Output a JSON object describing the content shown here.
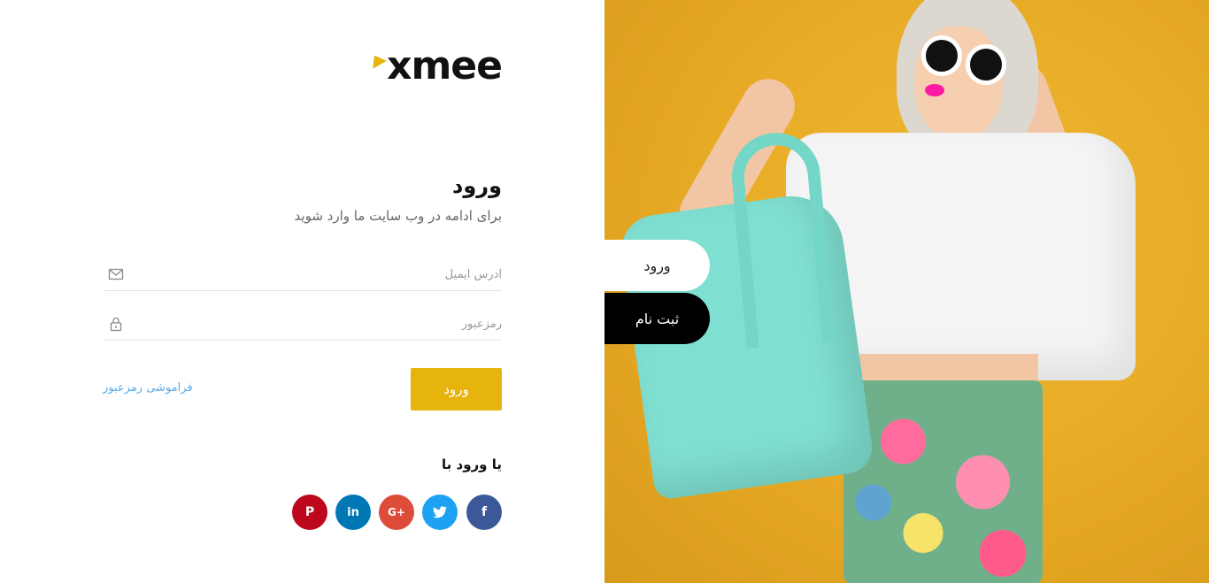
{
  "brand": {
    "logo_text": "xmee",
    "accent_color": "#e6b40c"
  },
  "login": {
    "title": "ورود",
    "subtitle": "برای ادامه در وب سایت ما وارد شوید",
    "email_placeholder": "آدرس ایمیل",
    "password_placeholder": "رمزعبور",
    "submit_label": "ورود",
    "forgot_label": "فراموشی رمزعبور"
  },
  "social": {
    "heading": "یا ورود با",
    "buttons": [
      {
        "name": "facebook",
        "glyph": "f",
        "color": "#3b5998"
      },
      {
        "name": "twitter",
        "glyph": "t",
        "color": "#1da1f2"
      },
      {
        "name": "google-plus",
        "glyph": "G+",
        "color": "#dd4b39"
      },
      {
        "name": "linkedin",
        "glyph": "in",
        "color": "#0077b5"
      },
      {
        "name": "pinterest",
        "glyph": "P",
        "color": "#bd081c"
      }
    ]
  },
  "tabs": {
    "login_label": "ورود",
    "register_label": "ثبت نام"
  },
  "icons": {
    "email": "envelope-icon",
    "password": "lock-icon"
  }
}
